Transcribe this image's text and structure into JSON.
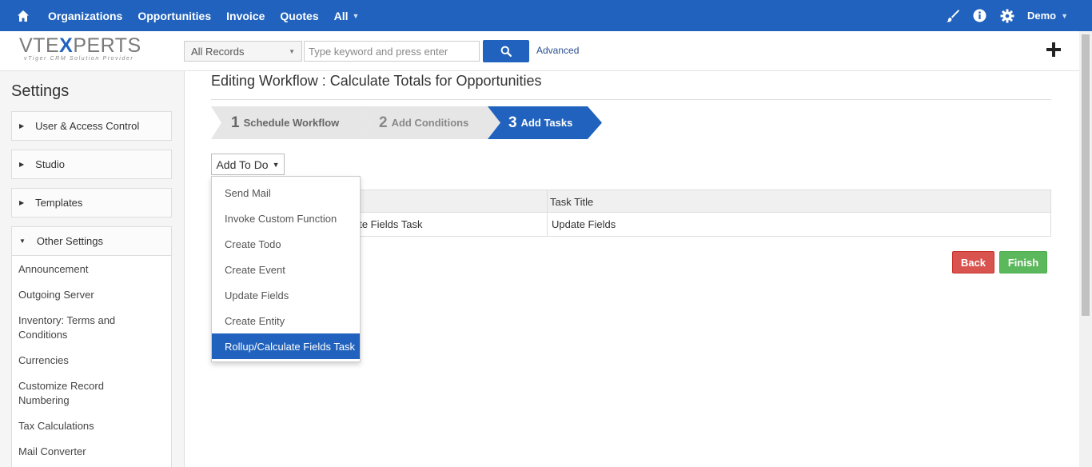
{
  "topnav": {
    "items": [
      "Organizations",
      "Opportunities",
      "Invoice",
      "Quotes",
      "All"
    ],
    "user": "Demo"
  },
  "header": {
    "logo_main": "VTEXPERTS",
    "logo_tagline": "vTiger CRM Solution Provider",
    "record_select": "All Records",
    "search_placeholder": "Type keyword and press enter",
    "advanced_link": "Advanced"
  },
  "sidebar": {
    "title": "Settings",
    "sections": [
      "User & Access Control",
      "Studio",
      "Templates",
      "Other Settings"
    ],
    "items": [
      "Announcement",
      "Outgoing Server",
      "Inventory: Terms and Conditions",
      "Currencies",
      "Customize Record Numbering",
      "Tax Calculations",
      "Mail Converter"
    ]
  },
  "main": {
    "title": "Editing Workflow : Calculate Totals for Opportunities",
    "steps": [
      {
        "num": "1",
        "label": "Schedule Workflow"
      },
      {
        "num": "2",
        "label": "Add Conditions"
      },
      {
        "num": "3",
        "label": "Add Tasks"
      }
    ],
    "add_button": "Add To Do",
    "table": {
      "header_task_title": "Task Title",
      "row_task_type_partial": "ate Fields Task",
      "row_task_title": "Update Fields"
    },
    "dropdown": [
      "Send Mail",
      "Invoke Custom Function",
      "Create Todo",
      "Create Event",
      "Update Fields",
      "Create Entity",
      "Rollup/Calculate Fields Task"
    ],
    "back_button": "Back",
    "finish_button": "Finish"
  },
  "colors": {
    "primary": "#2062bd",
    "danger": "#d9534f",
    "success": "#5cb85c",
    "step_inactive": "#e6e6e6"
  }
}
